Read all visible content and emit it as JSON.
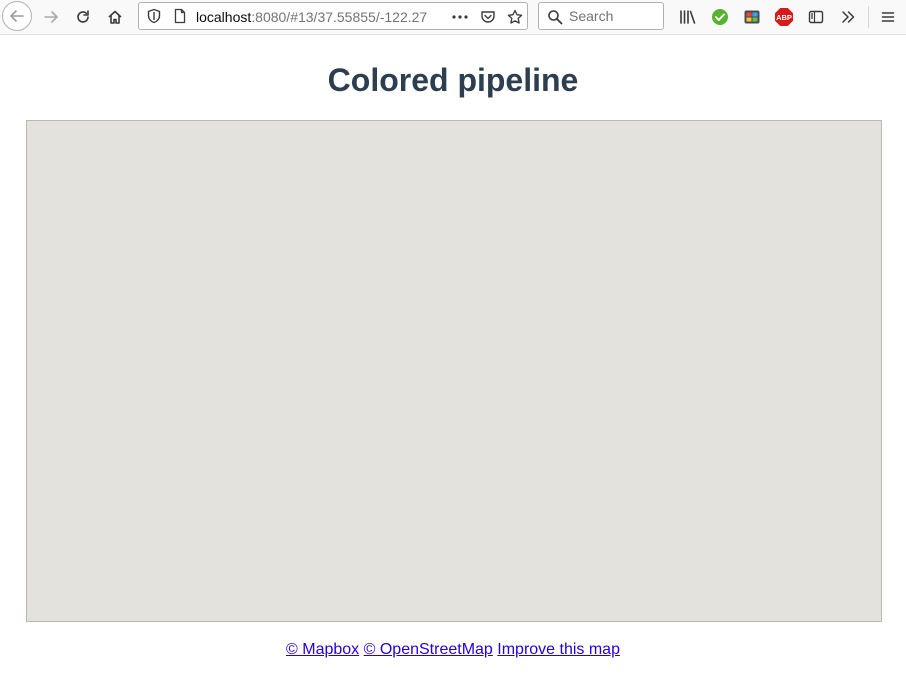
{
  "browser": {
    "url": {
      "host": "localhost",
      "rest": ":8080/#13/37.55855/-122.27"
    },
    "search": {
      "placeholder": "Search"
    },
    "extensions": {
      "abp_label": "ABP"
    }
  },
  "page": {
    "title": "Colored pipeline"
  },
  "attribution": {
    "links": [
      "© Mapbox",
      "© OpenStreetMap",
      "Improve this map"
    ]
  },
  "colors": {
    "title": "#2c3e50",
    "map_background": "#e4e2dd",
    "link": "#2200dd",
    "check_extension": "#55b32f",
    "abp_extension": "#d61a1a"
  },
  "icons": {
    "toolbar": [
      "arrow-left-icon",
      "arrow-right-icon",
      "reload-icon",
      "home-icon",
      "shield-icon",
      "page-icon",
      "more-icon",
      "pocket-icon",
      "star-icon",
      "search-icon",
      "library-icon",
      "check-icon",
      "extension-icon",
      "adblock-icon",
      "sidebar-icon",
      "overflow-icon",
      "menu-icon"
    ]
  }
}
